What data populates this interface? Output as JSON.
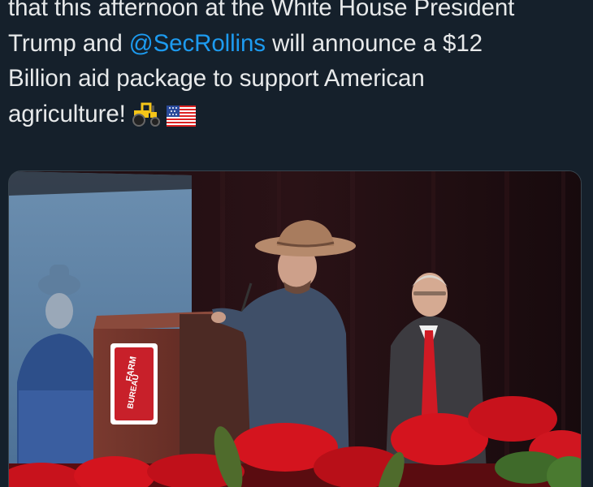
{
  "tweet": {
    "text_lines": [
      "that this afternoon at the White House President",
      "Billion aid package to support American",
      "agriculture!"
    ],
    "line2_prefix": "Trump and ",
    "mention": "@SecRollins",
    "line2_suffix": " will announce a $12",
    "emojis": [
      "tractor-emoji",
      "us-flag-emoji"
    ]
  },
  "media": {
    "type": "video-frame",
    "podium_sign_text": [
      "FARM",
      "BUREAU"
    ],
    "colors": {
      "background": "#15202b",
      "text": "#e7e9ea",
      "mention": "#1d9bf0",
      "podium": "#6b2e26",
      "sign_red": "#c8202a",
      "poinsettia": "#d4141e"
    }
  }
}
